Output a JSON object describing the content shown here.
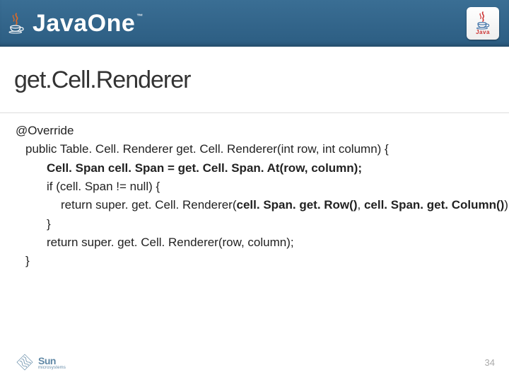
{
  "header": {
    "conference_name": "JavaOne",
    "trademark": "™",
    "badge_label": "Java"
  },
  "title": "get.Cell.Renderer",
  "code": {
    "l0": "@Override",
    "l1": "public Table. Cell. Renderer get. Cell. Renderer(int row, int column) {",
    "l2_pre": "Cell. Span cell. Span = get. Cell. Span. At(row, column);",
    "l3": "if (cell. Span != null) {",
    "l4_pre": "return super. get. Cell. Renderer(",
    "l4_b1": "cell. Span. get. Row()",
    "l4_mid": ", ",
    "l4_b2": "cell. Span. get. Column()",
    "l4_post": ");",
    "l5": "}",
    "l6": "return super. get. Cell. Renderer(row, column);",
    "l7": "}"
  },
  "footer": {
    "company": "Sun",
    "company_sub": "microsystems",
    "page_number": "34"
  }
}
